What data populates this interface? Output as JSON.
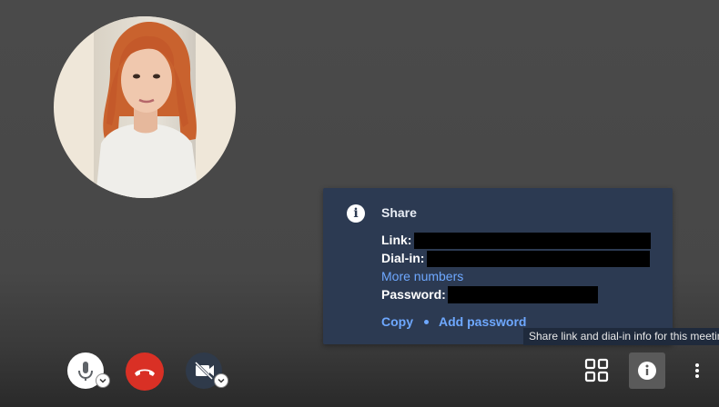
{
  "share": {
    "title": "Share",
    "link_label": "Link:",
    "dialin_label": "Dial-in:",
    "more_numbers": "More numbers",
    "password_label": "Password:",
    "copy": "Copy",
    "add_password": "Add password"
  },
  "tooltip": {
    "text": "Share link and dial-in info for this meetin"
  },
  "controls": {
    "mic": "microphone-icon",
    "hangup": "hang-up-icon",
    "camera": "camera-off-icon",
    "grid": "grid-view-icon",
    "info": "info-icon",
    "more": "more-vert-icon"
  },
  "colors": {
    "panel_bg": "#2c3a52",
    "link_blue": "#6ea8ff",
    "hangup_red": "#d93025"
  }
}
